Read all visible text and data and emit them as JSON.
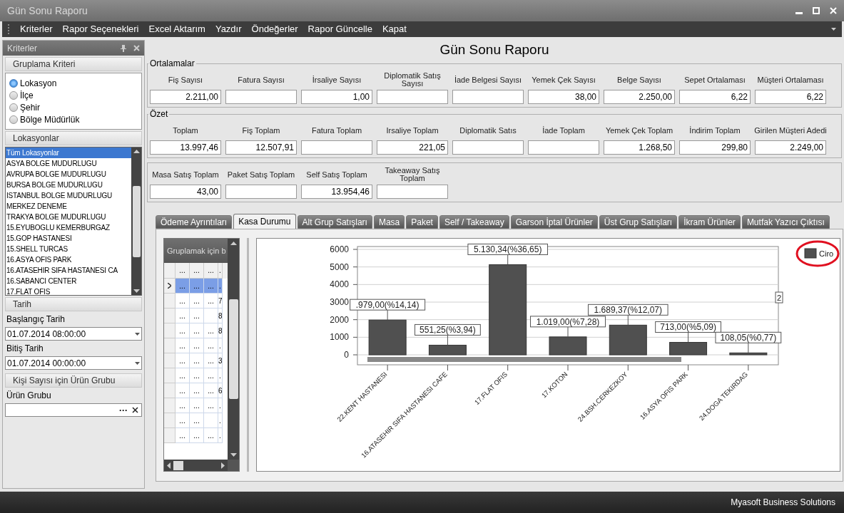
{
  "window": {
    "title": "Gün Sonu Raporu"
  },
  "menu": [
    "Kriterler",
    "Rapor Seçenekleri",
    "Excel Aktarım",
    "Yazdır",
    "Öndeğerler",
    "Rapor Güncelle",
    "Kapat"
  ],
  "criteria_panel": {
    "title": "Kriterler",
    "grouping": {
      "title": "Gruplama Kriteri",
      "options": [
        {
          "label": "Lokasyon",
          "selected": true
        },
        {
          "label": "İlçe",
          "selected": false
        },
        {
          "label": "Şehir",
          "selected": false
        },
        {
          "label": "Bölge Müdürlük",
          "selected": false
        }
      ]
    },
    "locations": {
      "title": "Lokasyonlar",
      "items": [
        {
          "label": "Tüm Lokasyonlar",
          "selected": true
        },
        {
          "label": "ASYA BOLGE MUDURLUGU",
          "selected": false
        },
        {
          "label": "AVRUPA BOLGE MUDURLUGU",
          "selected": false
        },
        {
          "label": "BURSA BOLGE MUDURLUGU",
          "selected": false
        },
        {
          "label": "ISTANBUL BOLGE MUDURLUGU",
          "selected": false
        },
        {
          "label": "MERKEZ DENEME",
          "selected": false
        },
        {
          "label": "TRAKYA BOLGE MUDURLUGU",
          "selected": false
        },
        {
          "label": "15.EYUBOGLU KEMERBURGAZ",
          "selected": false
        },
        {
          "label": "15.GOP HASTANESI",
          "selected": false
        },
        {
          "label": "15.SHELL TURCAS",
          "selected": false
        },
        {
          "label": "16.ASYA OFIS PARK",
          "selected": false
        },
        {
          "label": "16.ATASEHIR SIFA HASTANESI CA",
          "selected": false
        },
        {
          "label": "16.SABANCI CENTER",
          "selected": false
        },
        {
          "label": "17.FLAT OFIS",
          "selected": false
        }
      ]
    },
    "date": {
      "title": "Tarih",
      "start_label": "Başlangıç Tarih",
      "start_value": "01.07.2014 08:00:00",
      "end_label": "Bitiş Tarih",
      "end_value": "01.07.2014 00:00:00"
    },
    "product_group": {
      "title": "Kişi Sayısı için Ürün Grubu",
      "label": "Ürün Grubu",
      "button": "···"
    }
  },
  "report": {
    "title": "Gün Sonu Raporu",
    "sections": [
      {
        "title": "Ortalamalar",
        "fields": [
          {
            "label": "Fiş Sayısı",
            "value": "2.211,00"
          },
          {
            "label": "Fatura Sayısı"
          },
          {
            "label": "İrsaliye Sayısı",
            "value": "1,00"
          },
          {
            "label": "Diplomatik Satış Sayısı"
          },
          {
            "label": "İade Belgesi Sayısı"
          },
          {
            "label": "Yemek Çek Sayısı",
            "value": "38,00"
          },
          {
            "label": "Belge Sayısı",
            "value": "2.250,00"
          },
          {
            "label": "Sepet Ortalaması",
            "value": "6,22"
          },
          {
            "label": "Müşteri Ortalaması",
            "value": "6,22"
          }
        ]
      },
      {
        "title": "Özet",
        "fields": [
          {
            "label": "Toplam",
            "value": "13.997,46"
          },
          {
            "label": "Fiş Toplam",
            "value": "12.507,91"
          },
          {
            "label": "Fatura Toplam"
          },
          {
            "label": "Irsaliye Toplam",
            "value": "221,05"
          },
          {
            "label": "Diplomatik Satıs"
          },
          {
            "label": "İade Toplam"
          },
          {
            "label": "Yemek Çek Toplam",
            "value": "1.268,50"
          },
          {
            "label": "İndirim Toplam",
            "value": "299,80"
          },
          {
            "label": "Girilen Müşteri Adedi",
            "value": "2.249,00"
          }
        ]
      },
      {
        "fields": [
          {
            "label": "Masa Satış Toplam",
            "value": "43,00"
          },
          {
            "label": "Paket Satış Toplam"
          },
          {
            "label": "Self Satış Toplam",
            "value": "13.954,46"
          },
          {
            "label": "Takeaway Satış Toplam"
          }
        ]
      }
    ]
  },
  "tabs": [
    {
      "label": "Ödeme Ayrıntıları",
      "selected": false
    },
    {
      "label": "Kasa Durumu",
      "selected": true
    },
    {
      "label": "Alt Grup Satışları",
      "selected": false
    },
    {
      "label": "Masa",
      "selected": false
    },
    {
      "label": "Paket",
      "selected": false
    },
    {
      "label": "Self / Takeaway",
      "selected": false
    },
    {
      "label": "Garson İptal Ürünler",
      "selected": false
    },
    {
      "label": "Üst Grup Satışları",
      "selected": false
    },
    {
      "label": "İkram Ürünler",
      "selected": false
    },
    {
      "label": "Mutfak Yazıcı Çıktısı",
      "selected": false
    }
  ],
  "grid": {
    "group_hint": "Gruplamak için b",
    "header": [
      "...",
      "...",
      "...",
      "."
    ],
    "rows": [
      {
        "selected": true,
        "cells": [
          "...",
          "...",
          "...",
          "."
        ]
      },
      {
        "selected": false,
        "cells": [
          "...",
          "...",
          "...",
          "7"
        ]
      },
      {
        "selected": false,
        "cells": [
          "...",
          "...",
          "",
          "8"
        ]
      },
      {
        "selected": false,
        "cells": [
          "...",
          "...",
          "...",
          "8"
        ]
      },
      {
        "selected": false,
        "cells": [
          "...",
          "...",
          "...",
          "."
        ]
      },
      {
        "selected": false,
        "cells": [
          "...",
          "...",
          "...",
          "3"
        ]
      },
      {
        "selected": false,
        "cells": [
          "...",
          "...",
          "...",
          "."
        ]
      },
      {
        "selected": false,
        "cells": [
          "...",
          "...",
          "...",
          "6"
        ]
      },
      {
        "selected": false,
        "cells": [
          "...",
          "...",
          "...",
          "."
        ]
      },
      {
        "selected": false,
        "cells": [
          "...",
          "...",
          "",
          "."
        ]
      },
      {
        "selected": false,
        "cells": [
          "...",
          "...",
          "...",
          "."
        ]
      }
    ]
  },
  "chart": {
    "chart_data": {
      "type": "bar",
      "grid": true,
      "categories": [
        "22.KENT HASTANESI",
        "16.ATASEHIR SIFA HASTANESI CAFE",
        "17.FLAT OFIS",
        "17.KOTON",
        "24.BSH.CERKEZKOY",
        "16.ASYA OFIS PARK",
        "24.DOGA TEKIRDAG"
      ],
      "series": [
        {
          "name": "Ciro",
          "color": "#505050",
          "values": [
            1980,
            550,
            5130,
            1020,
            1690,
            710,
            110
          ]
        }
      ],
      "ylim": [
        0,
        6000
      ],
      "yticks": [
        0,
        1000,
        2000,
        3000,
        4000,
        5000,
        6000
      ],
      "value_labels": [
        ".979,00(%14,14)",
        "551,25(%3,94)",
        "5.130,34(%36,65)",
        "1.019,00(%7,28)",
        "1.689,37(%12,07)",
        "713,00(%5,09)",
        "108,05(%0,77)"
      ],
      "annotations": [
        "2"
      ]
    }
  },
  "status_bar": "Myasoft Business Solutions"
}
